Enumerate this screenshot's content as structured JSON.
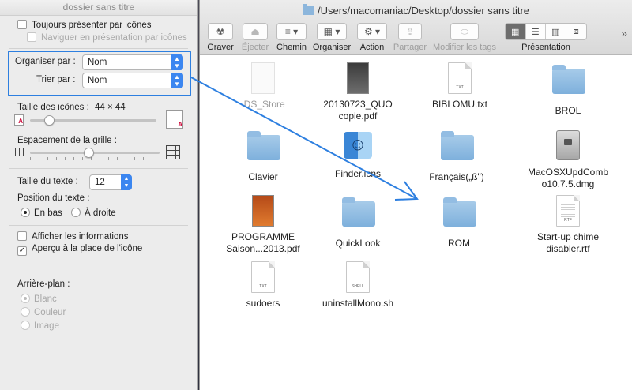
{
  "finder": {
    "path": "/Users/macomaniac/Desktop/dossier sans titre",
    "toolbar": [
      {
        "label": "Graver",
        "glyph": "☢",
        "disabled": false
      },
      {
        "label": "Éjecter",
        "glyph": "⏏",
        "disabled": true
      },
      {
        "label": "Chemin",
        "glyph": "≡ ▾",
        "disabled": false
      },
      {
        "label": "Organiser",
        "glyph": "▦ ▾",
        "disabled": false
      },
      {
        "label": "Action",
        "glyph": "⚙ ▾",
        "disabled": false
      },
      {
        "label": "Partager",
        "glyph": "⇪",
        "disabled": true
      },
      {
        "label": "Modifier les tags",
        "glyph": "⬭",
        "disabled": true
      }
    ],
    "presentation_label": "Présentation",
    "more": "»",
    "files": [
      {
        "name": ".DS_Store",
        "kind": "ghost"
      },
      {
        "name": "20130723_QUO copie.pdf",
        "kind": "pdf"
      },
      {
        "name": "BIBLOMU.txt",
        "kind": "txt",
        "tag": "TXT"
      },
      {
        "name": "BROL",
        "kind": "folder"
      },
      {
        "name": "Clavier",
        "kind": "folder"
      },
      {
        "name": "Finder.icns",
        "kind": "finder"
      },
      {
        "name": "Français(„ß\")",
        "kind": "folder"
      },
      {
        "name": "MacOSXUpdCombo10.7.5.dmg",
        "kind": "dmg"
      },
      {
        "name": "PROGRAMME Saison...2013.pdf",
        "kind": "pdf-orange"
      },
      {
        "name": "QuickLook",
        "kind": "folder"
      },
      {
        "name": "ROM",
        "kind": "folder"
      },
      {
        "name": "Start-up chime disabler.rtf",
        "kind": "txt",
        "tag": "RTF"
      },
      {
        "name": "sudoers",
        "kind": "txt",
        "tag": "TXT"
      },
      {
        "name": "uninstallMono.sh",
        "kind": "txt",
        "tag": "SHELL"
      }
    ]
  },
  "panel": {
    "title": "dossier sans titre",
    "always_icons": "Toujours présenter par icônes",
    "browse_icons": "Naviguer en présentation par icônes",
    "organize_label": "Organiser par :",
    "organize_value": "Nom",
    "sort_label": "Trier par :",
    "sort_value": "Nom",
    "icon_size_label": "Taille des icônes :",
    "icon_size_value": "44 × 44",
    "icon_size_fraction": 0.15,
    "grid_spacing_label": "Espacement de la grille :",
    "grid_spacing_fraction": 0.45,
    "text_size_label": "Taille du texte :",
    "text_size_value": "12",
    "text_position_label": "Position du texte :",
    "pos_bottom": "En bas",
    "pos_right": "À droite",
    "show_info": "Afficher les informations",
    "preview_icon": "Aperçu à la place de l'icône",
    "background_label": "Arrière-plan :",
    "bg_white": "Blanc",
    "bg_color": "Couleur",
    "bg_image": "Image"
  },
  "colors": {
    "accent": "#2d7fe0",
    "folder": "#8cb6dc"
  }
}
